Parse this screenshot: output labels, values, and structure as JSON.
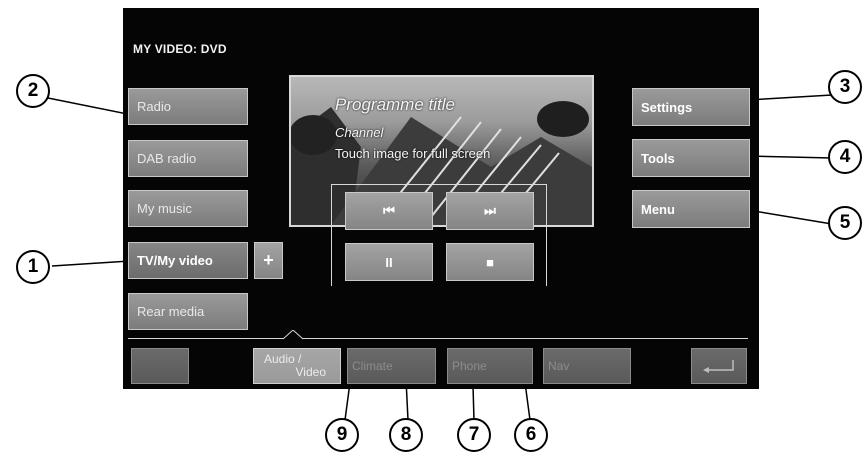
{
  "header": {
    "title": "MY VIDEO: DVD"
  },
  "sources": [
    {
      "label": "Radio"
    },
    {
      "label": "DAB radio"
    },
    {
      "label": "My music"
    },
    {
      "label": "TV/My video"
    },
    {
      "label": "Rear media"
    }
  ],
  "plus_label": "+",
  "preview": {
    "programme_title": "Programme title",
    "channel": "Channel",
    "hint": "Touch image for full screen"
  },
  "controls": {
    "prev_label": "⏮",
    "next_label": "⏭",
    "pause_label": "II",
    "stop_label": "■"
  },
  "right_menu": {
    "settings": "Settings",
    "tools": "Tools",
    "menu": "Menu"
  },
  "bottom_tabs": {
    "audio_video_line1": "Audio /",
    "audio_video_line2": "Video",
    "climate": "Climate",
    "phone": "Phone",
    "nav": "Nav"
  },
  "callouts": [
    "1",
    "2",
    "3",
    "4",
    "5",
    "6",
    "7",
    "8",
    "9"
  ]
}
